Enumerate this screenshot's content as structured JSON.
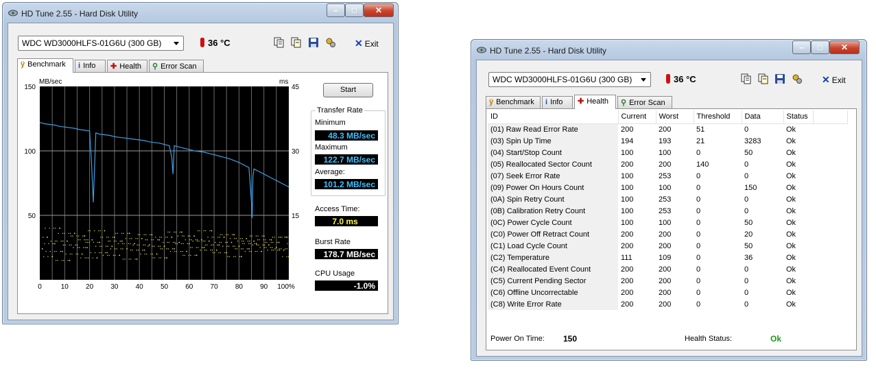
{
  "left_window": {
    "title": "HD Tune 2.55 - Hard Disk Utility",
    "drive": "WDC WD3000HLFS-01G6U (300 GB)",
    "temperature": "36 °C",
    "exit_label": "Exit",
    "tabs": [
      {
        "label": "Benchmark",
        "active": true
      },
      {
        "label": "Info",
        "active": false
      },
      {
        "label": "Health",
        "active": false
      },
      {
        "label": "Error Scan",
        "active": false
      }
    ],
    "start_label": "Start",
    "transfer_rate": {
      "group_title": "Transfer Rate",
      "min_label": "Minimum",
      "min_value": "48.3 MB/sec",
      "max_label": "Maximum",
      "max_value": "122.7 MB/sec",
      "avg_label": "Average:",
      "avg_value": "101.2 MB/sec"
    },
    "access_time_label": "Access Time:",
    "access_time_value": "7.0 ms",
    "burst_rate_label": "Burst Rate",
    "burst_rate_value": "178.7 MB/sec",
    "cpu_usage_label": "CPU Usage",
    "cpu_usage_value": "-1.0%"
  },
  "chart_data": {
    "type": "line",
    "y_left_label": "MB/sec",
    "y_right_label": "ms",
    "x_ticks": [
      "0",
      "10",
      "20",
      "30",
      "40",
      "50",
      "60",
      "70",
      "80",
      "90",
      "100%"
    ],
    "y_left_ticks": [
      "150",
      "100",
      "50"
    ],
    "y_right_ticks": [
      "45",
      "30",
      "15"
    ],
    "ylim_left": [
      0,
      150
    ],
    "ylim_right": [
      0,
      45
    ],
    "xlim": [
      0,
      100
    ],
    "grid": true,
    "series": [
      {
        "x": [
          0,
          2,
          4,
          6,
          8,
          10,
          12,
          14,
          16,
          18,
          20,
          20.8,
          21.5,
          22.5,
          24,
          26,
          28,
          30,
          32,
          34,
          36,
          38,
          40,
          42,
          44,
          46,
          48,
          50,
          52,
          53,
          53.5,
          54,
          56,
          58,
          60,
          62,
          64,
          66,
          68,
          70,
          72,
          74,
          76,
          78,
          80,
          82,
          84,
          85,
          85.3,
          85.6,
          86,
          88,
          90,
          92,
          94,
          96,
          98,
          100
        ],
        "y": [
          122,
          121,
          120.5,
          120,
          119,
          118.5,
          118,
          117.5,
          116.5,
          116,
          115.5,
          90,
          60,
          114,
          113,
          112.5,
          112,
          111,
          110.5,
          110,
          109.5,
          109,
          108.5,
          108,
          107,
          106.5,
          106,
          105,
          104,
          95,
          82,
          104,
          103,
          102,
          101,
          100,
          99.5,
          99,
          98,
          97,
          96,
          95,
          94,
          92.5,
          91,
          89,
          87,
          60,
          48,
          80,
          86,
          84,
          82,
          80,
          78,
          76,
          74,
          72
        ]
      },
      {
        "x": [
          1,
          3,
          5,
          6,
          8,
          9,
          11,
          12,
          14,
          15,
          17,
          18,
          19,
          21,
          23,
          24,
          26,
          27,
          29,
          30,
          32,
          33,
          35,
          36,
          38,
          39,
          41,
          42,
          44,
          45,
          47,
          48,
          50,
          51,
          53,
          54,
          56,
          57,
          59,
          60,
          62,
          63,
          65,
          66,
          68,
          69,
          71,
          72,
          74,
          75,
          77,
          78,
          80,
          81,
          83,
          84,
          86,
          87,
          89,
          90,
          92,
          93,
          95,
          96,
          98,
          99
        ],
        "y": [
          24,
          33,
          18,
          28,
          40,
          22,
          30,
          15,
          36,
          27,
          20,
          34,
          25,
          31,
          17,
          29,
          38,
          21,
          26,
          33,
          19,
          30,
          24,
          36,
          28,
          16,
          32,
          23,
          27,
          35,
          20,
          31,
          26,
          17,
          33,
          24,
          29,
          37,
          22,
          28,
          34,
          19,
          31,
          25,
          30,
          38,
          23,
          27,
          33,
          21,
          29,
          35,
          26,
          18,
          32,
          24,
          30,
          28,
          22,
          34,
          27,
          31,
          25,
          29,
          23,
          33
        ]
      }
    ]
  },
  "right_window": {
    "title": "HD Tune 2.55 - Hard Disk Utility",
    "drive": "WDC WD3000HLFS-01G6U (300 GB)",
    "temperature": "36 °C",
    "exit_label": "Exit",
    "tabs": [
      {
        "label": "Benchmark",
        "active": false
      },
      {
        "label": "Info",
        "active": false
      },
      {
        "label": "Health",
        "active": true
      },
      {
        "label": "Error Scan",
        "active": false
      }
    ],
    "columns": [
      "ID",
      "Current",
      "Worst",
      "Threshold",
      "Data",
      "Status"
    ],
    "rows": [
      [
        "(01) Raw Read Error Rate",
        "200",
        "200",
        "51",
        "0",
        "Ok"
      ],
      [
        "(03) Spin Up Time",
        "194",
        "193",
        "21",
        "3283",
        "Ok"
      ],
      [
        "(04) Start/Stop Count",
        "100",
        "100",
        "0",
        "50",
        "Ok"
      ],
      [
        "(05) Reallocated Sector Count",
        "200",
        "200",
        "140",
        "0",
        "Ok"
      ],
      [
        "(07) Seek Error Rate",
        "100",
        "253",
        "0",
        "0",
        "Ok"
      ],
      [
        "(09) Power On Hours Count",
        "100",
        "100",
        "0",
        "150",
        "Ok"
      ],
      [
        "(0A) Spin Retry Count",
        "100",
        "253",
        "0",
        "0",
        "Ok"
      ],
      [
        "(0B) Calibration Retry Count",
        "100",
        "253",
        "0",
        "0",
        "Ok"
      ],
      [
        "(0C) Power Cycle Count",
        "100",
        "100",
        "0",
        "50",
        "Ok"
      ],
      [
        "(C0) Power Off Retract Count",
        "200",
        "200",
        "0",
        "20",
        "Ok"
      ],
      [
        "(C1) Load Cycle Count",
        "200",
        "200",
        "0",
        "50",
        "Ok"
      ],
      [
        "(C2) Temperature",
        "111",
        "109",
        "0",
        "36",
        "Ok"
      ],
      [
        "(C4) Reallocated Event Count",
        "200",
        "200",
        "0",
        "0",
        "Ok"
      ],
      [
        "(C5) Current Pending Sector",
        "200",
        "200",
        "0",
        "0",
        "Ok"
      ],
      [
        "(C6) Offline Uncorrectable",
        "200",
        "200",
        "0",
        "0",
        "Ok"
      ],
      [
        "(C8) Write Error Rate",
        "200",
        "200",
        "0",
        "0",
        "Ok"
      ]
    ],
    "power_on_label": "Power On Time:",
    "power_on_value": "150",
    "health_label": "Health Status:",
    "health_value": "Ok",
    "health_color": "#1a9a1a"
  }
}
